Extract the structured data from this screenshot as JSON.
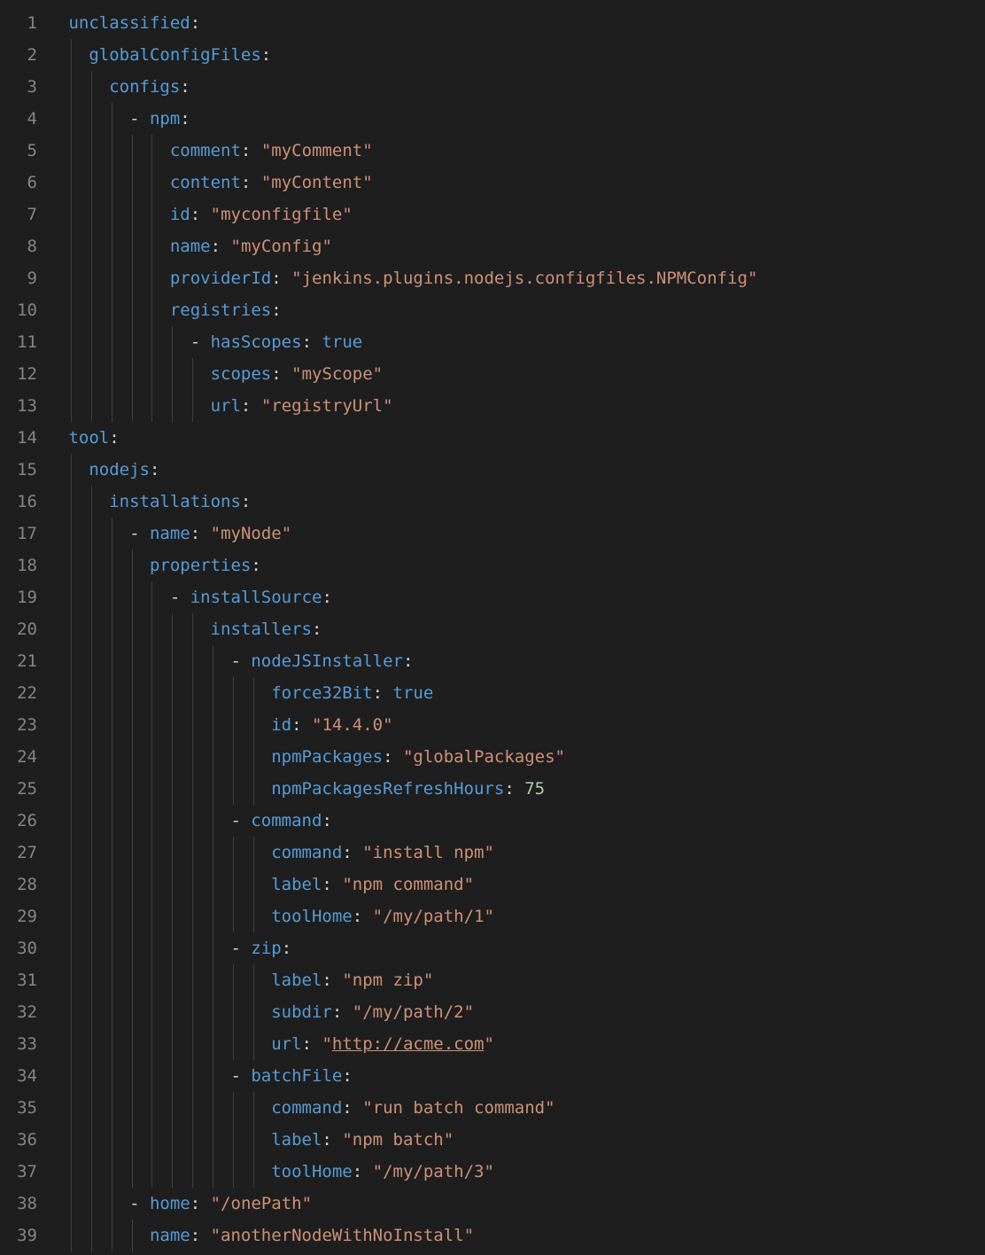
{
  "lineCount": 39,
  "colors": {
    "background": "#1e1e1e",
    "lineNumber": "#858585",
    "key": "#569cd6",
    "string": "#ce9178",
    "constant": "#569cd6",
    "number": "#b5cea8",
    "punctuation": "#d4d4d4",
    "indentGuide": "#404040"
  },
  "indentSize": 2,
  "lines": [
    {
      "n": 1,
      "indent": 0,
      "guides": [],
      "tokens": [
        {
          "t": "k",
          "v": "unclassified"
        },
        {
          "t": "p",
          "v": ":"
        }
      ]
    },
    {
      "n": 2,
      "indent": 1,
      "guides": [
        0
      ],
      "tokens": [
        {
          "t": "k",
          "v": "globalConfigFiles"
        },
        {
          "t": "p",
          "v": ":"
        }
      ]
    },
    {
      "n": 3,
      "indent": 2,
      "guides": [
        0,
        1
      ],
      "tokens": [
        {
          "t": "k",
          "v": "configs"
        },
        {
          "t": "p",
          "v": ":"
        }
      ]
    },
    {
      "n": 4,
      "indent": 3,
      "guides": [
        0,
        1,
        2
      ],
      "tokens": [
        {
          "t": "d",
          "v": "- "
        },
        {
          "t": "k",
          "v": "npm"
        },
        {
          "t": "p",
          "v": ":"
        }
      ]
    },
    {
      "n": 5,
      "indent": 5,
      "guides": [
        0,
        1,
        2,
        3,
        4
      ],
      "tokens": [
        {
          "t": "k",
          "v": "comment"
        },
        {
          "t": "p",
          "v": ": "
        },
        {
          "t": "s",
          "v": "\"myComment\""
        }
      ]
    },
    {
      "n": 6,
      "indent": 5,
      "guides": [
        0,
        1,
        2,
        3,
        4
      ],
      "tokens": [
        {
          "t": "k",
          "v": "content"
        },
        {
          "t": "p",
          "v": ": "
        },
        {
          "t": "s",
          "v": "\"myContent\""
        }
      ]
    },
    {
      "n": 7,
      "indent": 5,
      "guides": [
        0,
        1,
        2,
        3,
        4
      ],
      "tokens": [
        {
          "t": "k",
          "v": "id"
        },
        {
          "t": "p",
          "v": ": "
        },
        {
          "t": "s",
          "v": "\"myconfigfile\""
        }
      ]
    },
    {
      "n": 8,
      "indent": 5,
      "guides": [
        0,
        1,
        2,
        3,
        4
      ],
      "tokens": [
        {
          "t": "k",
          "v": "name"
        },
        {
          "t": "p",
          "v": ": "
        },
        {
          "t": "s",
          "v": "\"myConfig\""
        }
      ]
    },
    {
      "n": 9,
      "indent": 5,
      "guides": [
        0,
        1,
        2,
        3,
        4
      ],
      "tokens": [
        {
          "t": "k",
          "v": "providerId"
        },
        {
          "t": "p",
          "v": ": "
        },
        {
          "t": "s",
          "v": "\"jenkins.plugins.nodejs.configfiles.NPMConfig\""
        }
      ]
    },
    {
      "n": 10,
      "indent": 5,
      "guides": [
        0,
        1,
        2,
        3,
        4
      ],
      "tokens": [
        {
          "t": "k",
          "v": "registries"
        },
        {
          "t": "p",
          "v": ":"
        }
      ]
    },
    {
      "n": 11,
      "indent": 6,
      "guides": [
        0,
        1,
        2,
        3,
        4,
        5
      ],
      "tokens": [
        {
          "t": "d",
          "v": "- "
        },
        {
          "t": "k",
          "v": "hasScopes"
        },
        {
          "t": "p",
          "v": ": "
        },
        {
          "t": "c",
          "v": "true"
        }
      ]
    },
    {
      "n": 12,
      "indent": 7,
      "guides": [
        0,
        1,
        2,
        3,
        4,
        5,
        6
      ],
      "tokens": [
        {
          "t": "k",
          "v": "scopes"
        },
        {
          "t": "p",
          "v": ": "
        },
        {
          "t": "s",
          "v": "\"myScope\""
        }
      ]
    },
    {
      "n": 13,
      "indent": 7,
      "guides": [
        0,
        1,
        2,
        3,
        4,
        5,
        6
      ],
      "tokens": [
        {
          "t": "k",
          "v": "url"
        },
        {
          "t": "p",
          "v": ": "
        },
        {
          "t": "s",
          "v": "\"registryUrl\""
        }
      ]
    },
    {
      "n": 14,
      "indent": 0,
      "guides": [],
      "tokens": [
        {
          "t": "k",
          "v": "tool"
        },
        {
          "t": "p",
          "v": ":"
        }
      ]
    },
    {
      "n": 15,
      "indent": 1,
      "guides": [
        0
      ],
      "tokens": [
        {
          "t": "k",
          "v": "nodejs"
        },
        {
          "t": "p",
          "v": ":"
        }
      ]
    },
    {
      "n": 16,
      "indent": 2,
      "guides": [
        0,
        1
      ],
      "tokens": [
        {
          "t": "k",
          "v": "installations"
        },
        {
          "t": "p",
          "v": ":"
        }
      ]
    },
    {
      "n": 17,
      "indent": 3,
      "guides": [
        0,
        1,
        2
      ],
      "tokens": [
        {
          "t": "d",
          "v": "- "
        },
        {
          "t": "k",
          "v": "name"
        },
        {
          "t": "p",
          "v": ": "
        },
        {
          "t": "s",
          "v": "\"myNode\""
        }
      ]
    },
    {
      "n": 18,
      "indent": 4,
      "guides": [
        0,
        1,
        2,
        3
      ],
      "tokens": [
        {
          "t": "k",
          "v": "properties"
        },
        {
          "t": "p",
          "v": ":"
        }
      ]
    },
    {
      "n": 19,
      "indent": 5,
      "guides": [
        0,
        1,
        2,
        3,
        4
      ],
      "tokens": [
        {
          "t": "d",
          "v": "- "
        },
        {
          "t": "k",
          "v": "installSource"
        },
        {
          "t": "p",
          "v": ":"
        }
      ]
    },
    {
      "n": 20,
      "indent": 7,
      "guides": [
        0,
        1,
        2,
        3,
        4,
        5,
        6
      ],
      "tokens": [
        {
          "t": "k",
          "v": "installers"
        },
        {
          "t": "p",
          "v": ":"
        }
      ]
    },
    {
      "n": 21,
      "indent": 8,
      "guides": [
        0,
        1,
        2,
        3,
        4,
        5,
        6,
        7
      ],
      "tokens": [
        {
          "t": "d",
          "v": "- "
        },
        {
          "t": "k",
          "v": "nodeJSInstaller"
        },
        {
          "t": "p",
          "v": ":"
        }
      ]
    },
    {
      "n": 22,
      "indent": 10,
      "guides": [
        0,
        1,
        2,
        3,
        4,
        5,
        6,
        7,
        8,
        9
      ],
      "tokens": [
        {
          "t": "k",
          "v": "force32Bit"
        },
        {
          "t": "p",
          "v": ": "
        },
        {
          "t": "c",
          "v": "true"
        }
      ]
    },
    {
      "n": 23,
      "indent": 10,
      "guides": [
        0,
        1,
        2,
        3,
        4,
        5,
        6,
        7,
        8,
        9
      ],
      "tokens": [
        {
          "t": "k",
          "v": "id"
        },
        {
          "t": "p",
          "v": ": "
        },
        {
          "t": "s",
          "v": "\"14.4.0\""
        }
      ]
    },
    {
      "n": 24,
      "indent": 10,
      "guides": [
        0,
        1,
        2,
        3,
        4,
        5,
        6,
        7,
        8,
        9
      ],
      "tokens": [
        {
          "t": "k",
          "v": "npmPackages"
        },
        {
          "t": "p",
          "v": ": "
        },
        {
          "t": "s",
          "v": "\"globalPackages\""
        }
      ]
    },
    {
      "n": 25,
      "indent": 10,
      "guides": [
        0,
        1,
        2,
        3,
        4,
        5,
        6,
        7,
        8,
        9
      ],
      "tokens": [
        {
          "t": "k",
          "v": "npmPackagesRefreshHours"
        },
        {
          "t": "p",
          "v": ": "
        },
        {
          "t": "n",
          "v": "75"
        }
      ]
    },
    {
      "n": 26,
      "indent": 8,
      "guides": [
        0,
        1,
        2,
        3,
        4,
        5,
        6,
        7
      ],
      "tokens": [
        {
          "t": "d",
          "v": "- "
        },
        {
          "t": "k",
          "v": "command"
        },
        {
          "t": "p",
          "v": ":"
        }
      ]
    },
    {
      "n": 27,
      "indent": 10,
      "guides": [
        0,
        1,
        2,
        3,
        4,
        5,
        6,
        7,
        8,
        9
      ],
      "tokens": [
        {
          "t": "k",
          "v": "command"
        },
        {
          "t": "p",
          "v": ": "
        },
        {
          "t": "s",
          "v": "\"install npm\""
        }
      ]
    },
    {
      "n": 28,
      "indent": 10,
      "guides": [
        0,
        1,
        2,
        3,
        4,
        5,
        6,
        7,
        8,
        9
      ],
      "tokens": [
        {
          "t": "k",
          "v": "label"
        },
        {
          "t": "p",
          "v": ": "
        },
        {
          "t": "s",
          "v": "\"npm command\""
        }
      ]
    },
    {
      "n": 29,
      "indent": 10,
      "guides": [
        0,
        1,
        2,
        3,
        4,
        5,
        6,
        7,
        8,
        9
      ],
      "tokens": [
        {
          "t": "k",
          "v": "toolHome"
        },
        {
          "t": "p",
          "v": ": "
        },
        {
          "t": "s",
          "v": "\"/my/path/1\""
        }
      ]
    },
    {
      "n": 30,
      "indent": 8,
      "guides": [
        0,
        1,
        2,
        3,
        4,
        5,
        6,
        7
      ],
      "tokens": [
        {
          "t": "d",
          "v": "- "
        },
        {
          "t": "k",
          "v": "zip"
        },
        {
          "t": "p",
          "v": ":"
        }
      ]
    },
    {
      "n": 31,
      "indent": 10,
      "guides": [
        0,
        1,
        2,
        3,
        4,
        5,
        6,
        7,
        8,
        9
      ],
      "tokens": [
        {
          "t": "k",
          "v": "label"
        },
        {
          "t": "p",
          "v": ": "
        },
        {
          "t": "s",
          "v": "\"npm zip\""
        }
      ]
    },
    {
      "n": 32,
      "indent": 10,
      "guides": [
        0,
        1,
        2,
        3,
        4,
        5,
        6,
        7,
        8,
        9
      ],
      "tokens": [
        {
          "t": "k",
          "v": "subdir"
        },
        {
          "t": "p",
          "v": ": "
        },
        {
          "t": "s",
          "v": "\"/my/path/2\""
        }
      ]
    },
    {
      "n": 33,
      "indent": 10,
      "guides": [
        0,
        1,
        2,
        3,
        4,
        5,
        6,
        7,
        8,
        9
      ],
      "tokens": [
        {
          "t": "k",
          "v": "url"
        },
        {
          "t": "p",
          "v": ": "
        },
        {
          "t": "s",
          "v": "\""
        },
        {
          "t": "s",
          "v": "http://acme.com",
          "u": true
        },
        {
          "t": "s",
          "v": "\""
        }
      ]
    },
    {
      "n": 34,
      "indent": 8,
      "guides": [
        0,
        1,
        2,
        3,
        4,
        5,
        6,
        7
      ],
      "tokens": [
        {
          "t": "d",
          "v": "- "
        },
        {
          "t": "k",
          "v": "batchFile"
        },
        {
          "t": "p",
          "v": ":"
        }
      ]
    },
    {
      "n": 35,
      "indent": 10,
      "guides": [
        0,
        1,
        2,
        3,
        4,
        5,
        6,
        7,
        8,
        9
      ],
      "tokens": [
        {
          "t": "k",
          "v": "command"
        },
        {
          "t": "p",
          "v": ": "
        },
        {
          "t": "s",
          "v": "\"run batch command\""
        }
      ]
    },
    {
      "n": 36,
      "indent": 10,
      "guides": [
        0,
        1,
        2,
        3,
        4,
        5,
        6,
        7,
        8,
        9
      ],
      "tokens": [
        {
          "t": "k",
          "v": "label"
        },
        {
          "t": "p",
          "v": ": "
        },
        {
          "t": "s",
          "v": "\"npm batch\""
        }
      ]
    },
    {
      "n": 37,
      "indent": 10,
      "guides": [
        0,
        1,
        2,
        3,
        4,
        5,
        6,
        7,
        8,
        9
      ],
      "tokens": [
        {
          "t": "k",
          "v": "toolHome"
        },
        {
          "t": "p",
          "v": ": "
        },
        {
          "t": "s",
          "v": "\"/my/path/3\""
        }
      ]
    },
    {
      "n": 38,
      "indent": 3,
      "guides": [
        0,
        1,
        2
      ],
      "tokens": [
        {
          "t": "d",
          "v": "- "
        },
        {
          "t": "k",
          "v": "home"
        },
        {
          "t": "p",
          "v": ": "
        },
        {
          "t": "s",
          "v": "\"/onePath\""
        }
      ]
    },
    {
      "n": 39,
      "indent": 4,
      "guides": [
        0,
        1,
        2,
        3
      ],
      "tokens": [
        {
          "t": "k",
          "v": "name"
        },
        {
          "t": "p",
          "v": ": "
        },
        {
          "t": "s",
          "v": "\"anotherNodeWithNoInstall\""
        }
      ]
    }
  ]
}
